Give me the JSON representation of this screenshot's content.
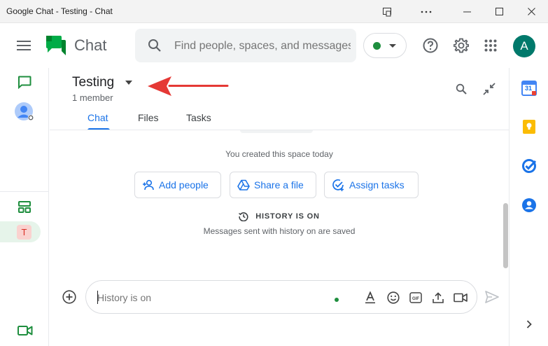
{
  "window": {
    "title": "Google Chat - Testing - Chat"
  },
  "appbar": {
    "app_name": "Chat",
    "search_placeholder": "Find people, spaces, and messages",
    "status_color": "#1e8e3e",
    "avatar_letter": "A",
    "avatar_color": "#00796b"
  },
  "leftrail": {
    "items": [
      {
        "icon": "chat-icon"
      },
      {
        "icon": "account-icon"
      },
      {
        "icon": "spaces-icon"
      },
      {
        "icon": "meet-icon"
      }
    ],
    "space_avatar_letter": "T"
  },
  "space": {
    "name": "Testing",
    "members": "1 member",
    "tabs": [
      {
        "label": "Chat",
        "active": true
      },
      {
        "label": "Files",
        "active": false
      },
      {
        "label": "Tasks",
        "active": false
      }
    ]
  },
  "feed": {
    "created_text": "You created this space today",
    "actions": [
      {
        "label": "Add people",
        "icon": "add-person-icon"
      },
      {
        "label": "Share a file",
        "icon": "drive-icon"
      },
      {
        "label": "Assign tasks",
        "icon": "add-task-icon"
      }
    ],
    "history_title": "HISTORY IS ON",
    "history_subtitle": "Messages sent with history on are saved"
  },
  "composer": {
    "placeholder": "History is on",
    "tools": [
      "format-text-icon",
      "emoji-icon",
      "gif-icon",
      "upload-icon",
      "video-call-icon"
    ]
  },
  "rightrail": {
    "items": [
      "calendar-icon",
      "keep-icon",
      "tasks-icon",
      "contacts-icon"
    ],
    "calendar_day": "31"
  },
  "colors": {
    "accent": "#1a73e8",
    "annotation_arrow": "#e53935"
  }
}
